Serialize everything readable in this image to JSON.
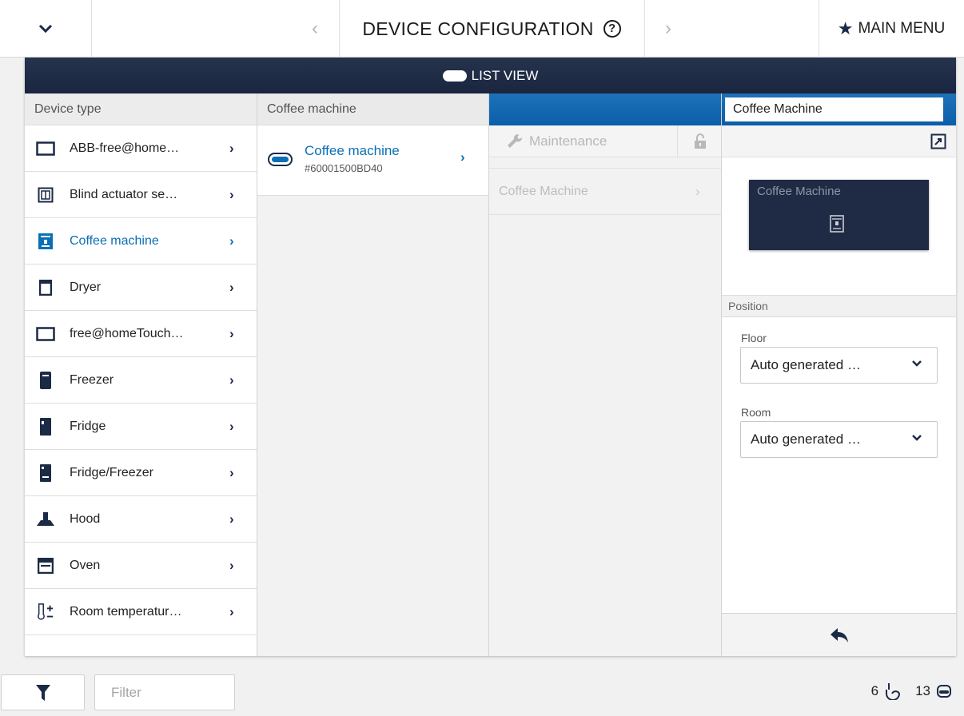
{
  "topbar": {
    "title": "DEVICE CONFIGURATION",
    "help_symbol": "?",
    "prev_symbol": "‹",
    "next_symbol": "›",
    "main_menu_label": "MAIN MENU",
    "dropdown_icon": "chevron-down-icon"
  },
  "listview": {
    "label": "LIST VIEW"
  },
  "device_types": {
    "header": "Device type",
    "items": [
      {
        "label": "ABB-free@homeTouch",
        "display": "ABB-free@home…",
        "icon": "display-icon"
      },
      {
        "label": "Blind actuator sensor",
        "display": "Blind actuator se…",
        "icon": "blind-actuator-icon"
      },
      {
        "label": "Coffee machine",
        "display": "Coffee machine",
        "icon": "coffee-machine-icon",
        "active": true
      },
      {
        "label": "Dryer",
        "display": "Dryer",
        "icon": "dryer-icon"
      },
      {
        "label": "free@homeTouch",
        "display": "free@homeTouch…",
        "icon": "display-icon"
      },
      {
        "label": "Freezer",
        "display": "Freezer",
        "icon": "freezer-icon"
      },
      {
        "label": "Fridge",
        "display": "Fridge",
        "icon": "fridge-icon"
      },
      {
        "label": "Fridge/Freezer",
        "display": "Fridge/Freezer",
        "icon": "fridge-freezer-icon"
      },
      {
        "label": "Hood",
        "display": "Hood",
        "icon": "hood-icon"
      },
      {
        "label": "Oven",
        "display": "Oven",
        "icon": "oven-icon"
      },
      {
        "label": "Room temperature",
        "display": "Room temperatur…",
        "icon": "thermostat-icon"
      }
    ]
  },
  "channels": {
    "header": "Coffee machine",
    "item_title": "Coffee machine",
    "item_serial": "#60001500BD40"
  },
  "functions": {
    "maintenance_label": "Maintenance",
    "item_label": "Coffee Machine"
  },
  "details": {
    "name_value": "Coffee Machine",
    "tile_label": "Coffee Machine",
    "position_header": "Position",
    "floor_label": "Floor",
    "floor_value": "Auto generated …",
    "room_label": "Room",
    "room_value": "Auto generated …"
  },
  "bottombar": {
    "filter_placeholder": "Filter",
    "sensor_count": "6",
    "device_count": "13"
  },
  "colors": {
    "accent_blue": "#0a6fb5",
    "header_navy": "#1a2640",
    "tile_navy": "#1f2b44"
  }
}
